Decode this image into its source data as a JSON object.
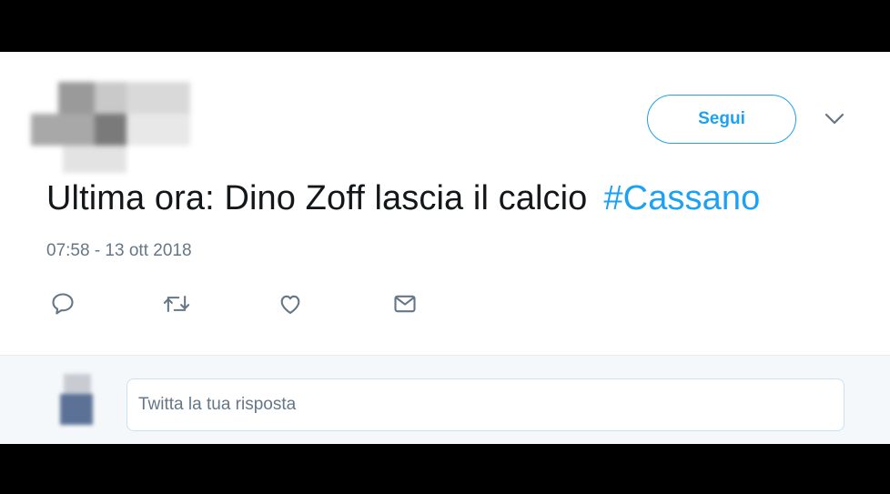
{
  "header": {
    "follow_label": "Segui"
  },
  "tweet": {
    "text": "Ultima ora: Dino Zoff lascia il calcio",
    "hashtag": "#Cassano",
    "timestamp": "07:58 - 13 ott 2018"
  },
  "actions": [
    {
      "icon": "reply-icon"
    },
    {
      "icon": "retweet-icon"
    },
    {
      "icon": "like-icon"
    },
    {
      "icon": "direct-message-icon"
    }
  ],
  "reply": {
    "placeholder": "Twitta la tua risposta"
  },
  "colors": {
    "accent": "#1DA1F2",
    "text": "#14171A",
    "muted": "#657786",
    "reply_bg": "#F5F8FA"
  }
}
